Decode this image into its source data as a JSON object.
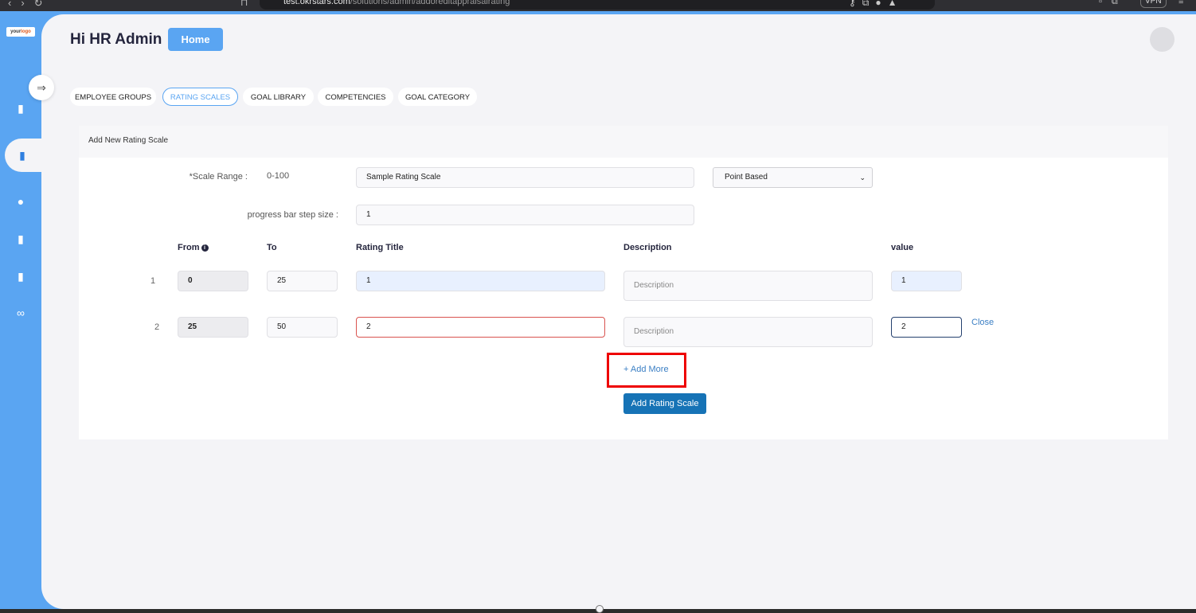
{
  "browser": {
    "url_host": "test.okrstars.com",
    "url_path": "/solutions/admin/addoreditappraisalrating",
    "vpn_label": "VPN"
  },
  "sidebar": {
    "logo_text": "your",
    "logo_accent": "logo"
  },
  "header": {
    "greeting": "Hi HR Admin",
    "home_label": "Home"
  },
  "tabs": [
    {
      "label": "EMPLOYEE GROUPS",
      "active": false
    },
    {
      "label": "RATING SCALES",
      "active": true
    },
    {
      "label": "GOAL LIBRARY",
      "active": false
    },
    {
      "label": "COMPETENCIES",
      "active": false
    },
    {
      "label": "GOAL CATEGORY",
      "active": false
    }
  ],
  "card": {
    "title": "Add New Rating Scale",
    "scale_range_label": "*Scale Range :",
    "scale_range_value": "0-100",
    "scale_name_value": "Sample Rating Scale",
    "scale_type_selected": "Point Based",
    "step_label": "progress bar step size :",
    "step_value": "1",
    "columns": {
      "from": "From",
      "to": "To",
      "rating_title": "Rating Title",
      "description": "Description",
      "value": "value"
    },
    "rows": [
      {
        "num": "1",
        "from": "0",
        "to": "25",
        "title": "1",
        "description_placeholder": "Description",
        "value": "1"
      },
      {
        "num": "2",
        "from": "25",
        "to": "50",
        "title": "2",
        "description_placeholder": "Description",
        "value": "2"
      }
    ],
    "close_label": "Close",
    "add_more_label": "+ Add More",
    "add_button_label": "Add Rating Scale"
  },
  "colors": {
    "brand_blue": "#5aa5f2",
    "primary_button": "#1673b6",
    "highlight_box": "#e00000",
    "error_border": "#d9534f"
  }
}
